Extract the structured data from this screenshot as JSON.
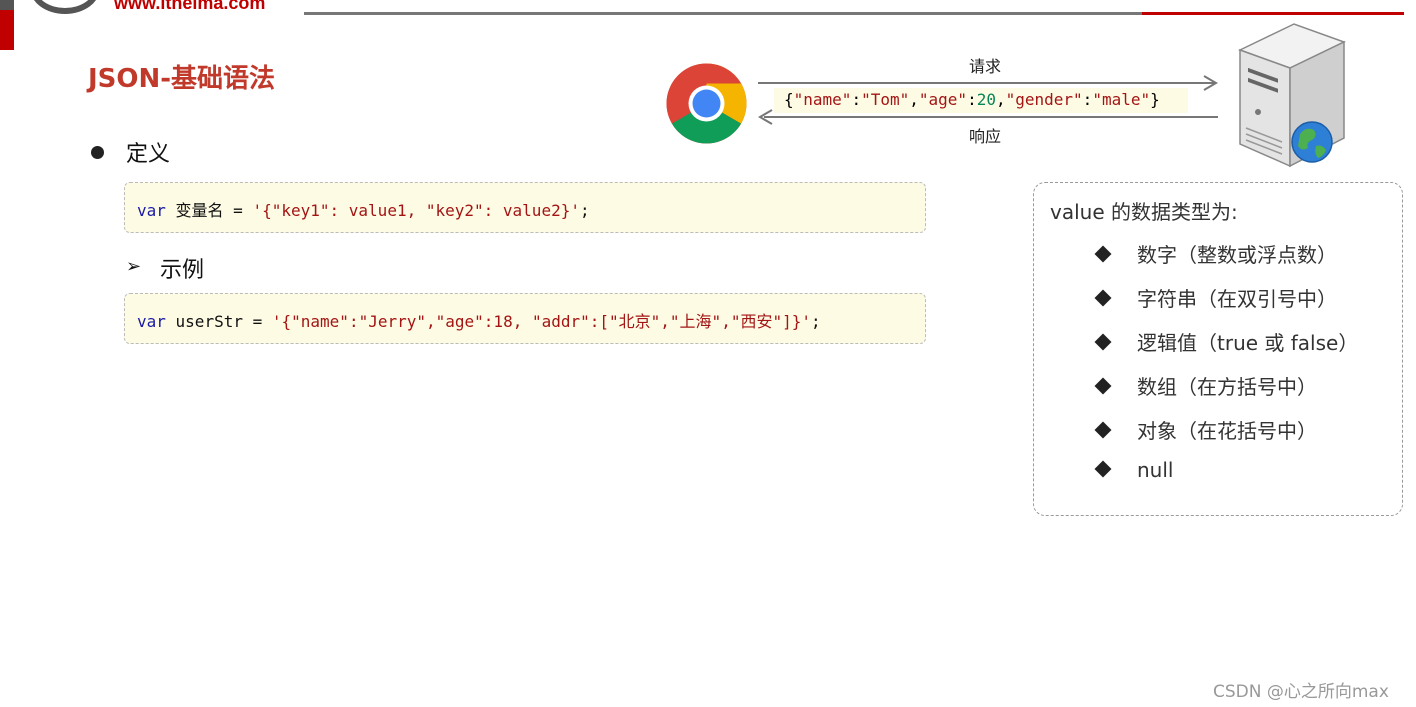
{
  "header": {
    "logo_url_text": "www.itheima.com"
  },
  "title": "JSON-基础语法",
  "definition": {
    "label": "定义",
    "code": {
      "keyword": "var",
      "plain": " 变量名 = ",
      "string": "'{\"key1\": value1, \"key2\": value2}'",
      "end": ";"
    }
  },
  "example": {
    "label": "示例",
    "code": {
      "keyword": "var",
      "plain": " userStr = ",
      "string": "'{\"name\":\"Jerry\",\"age\":18, \"addr\":[\"北京\",\"上海\",\"西安\"]}'",
      "end": ";"
    }
  },
  "diagram": {
    "request_label": "请求",
    "response_label": "响应",
    "json_parts": {
      "open": "{",
      "k1": "\"name\"",
      "c1": ":",
      "v1": "\"Tom\"",
      "s1": ",",
      "k2": "\"age\"",
      "c2": ":",
      "v2": "20",
      "s2": ",",
      "k3": "\"gender\"",
      "c3": ":",
      "v3": "\"male\"",
      "close": "}"
    }
  },
  "value_types": {
    "title": "value 的数据类型为:",
    "items": [
      "数字（整数或浮点数）",
      "字符串（在双引号中）",
      "逻辑值（true 或 false）",
      "数组（在方括号中）",
      "对象（在花括号中）",
      "null"
    ]
  },
  "watermark": "CSDN @心之所向max",
  "colors": {
    "accent_red": "#c00000",
    "title_red": "#c0392b",
    "code_bg": "#fdfbe4",
    "keyword_blue": "#1a1aa6",
    "string_red": "#a31515"
  }
}
